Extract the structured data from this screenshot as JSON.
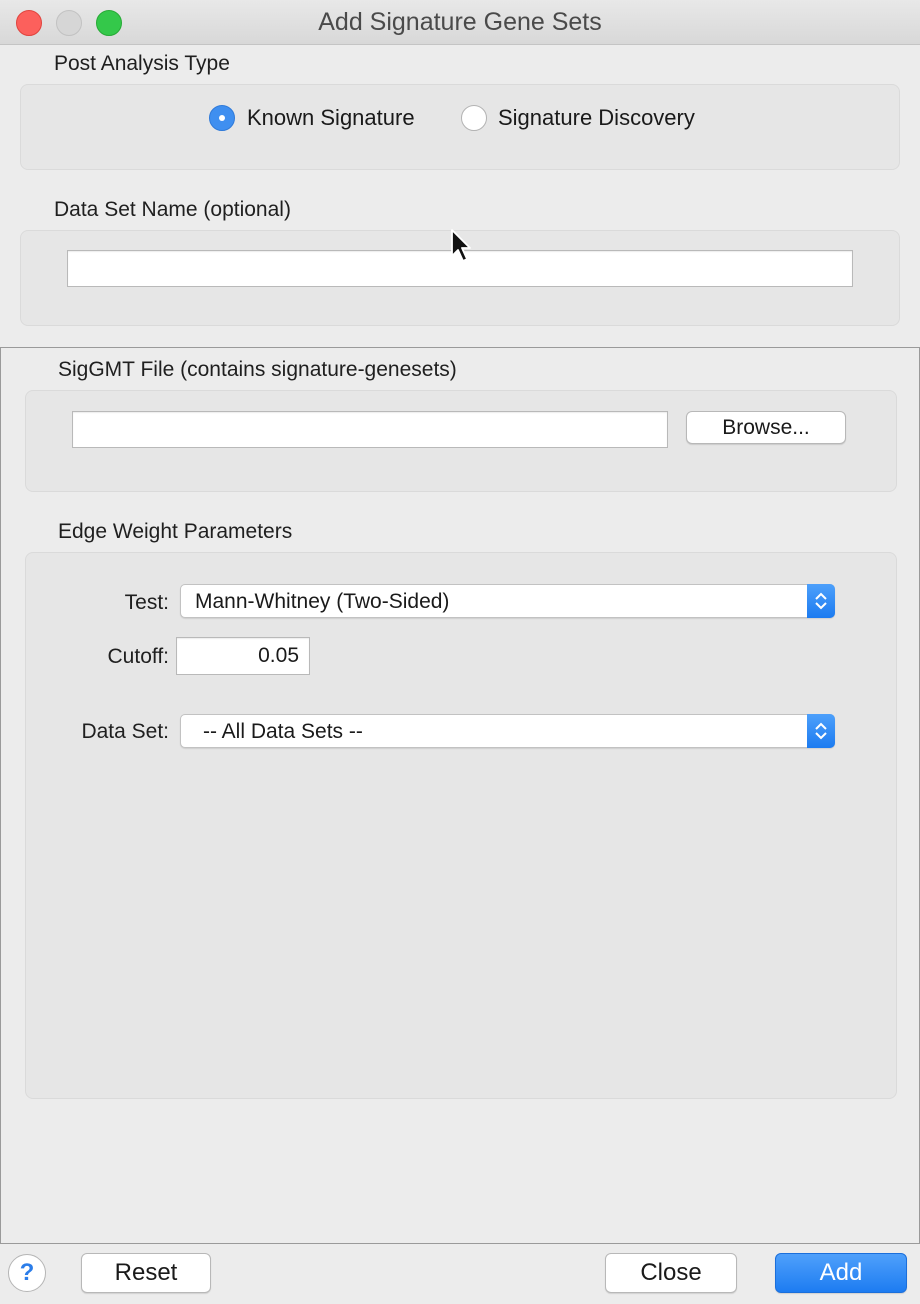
{
  "window": {
    "title": "Add Signature Gene Sets"
  },
  "post_analysis": {
    "heading": "Post Analysis Type",
    "options": [
      {
        "label": "Known Signature",
        "selected": true
      },
      {
        "label": "Signature Discovery",
        "selected": false
      }
    ]
  },
  "dataset_name": {
    "heading": "Data Set Name (optional)",
    "value": ""
  },
  "siggmt": {
    "heading": "SigGMT File (contains signature-genesets)",
    "value": "",
    "browse_label": "Browse..."
  },
  "edge_weight": {
    "heading": "Edge Weight Parameters",
    "test_label": "Test:",
    "test_value": "Mann-Whitney (Two-Sided)",
    "cutoff_label": "Cutoff:",
    "cutoff_value": "0.05",
    "dataset_label": "Data Set:",
    "dataset_value": "-- All Data Sets --"
  },
  "footer": {
    "help_label": "?",
    "reset_label": "Reset",
    "close_label": "Close",
    "add_label": "Add"
  },
  "colors": {
    "accent": "#1d7cf1",
    "close": "#fc605c",
    "minimize": "#d6d6d6",
    "zoom": "#34c84a"
  }
}
